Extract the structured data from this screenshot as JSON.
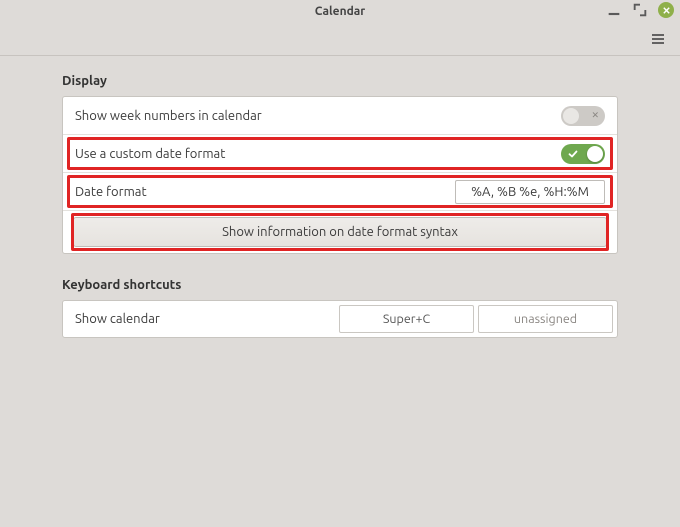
{
  "window": {
    "title": "Calendar"
  },
  "sections": {
    "display": {
      "title": "Display",
      "rows": {
        "show_week": {
          "label": "Show week numbers in calendar",
          "value": false
        },
        "custom_format": {
          "label": "Use a custom date format",
          "value": true
        },
        "date_format": {
          "label": "Date format",
          "value": "%A, %B %e, %H:%M"
        },
        "syntax_button": {
          "label": "Show information on date format syntax"
        }
      }
    },
    "shortcuts": {
      "title": "Keyboard shortcuts",
      "rows": {
        "show_calendar": {
          "label": "Show calendar",
          "accel1": "Super+C",
          "accel2": "unassigned"
        }
      }
    }
  }
}
